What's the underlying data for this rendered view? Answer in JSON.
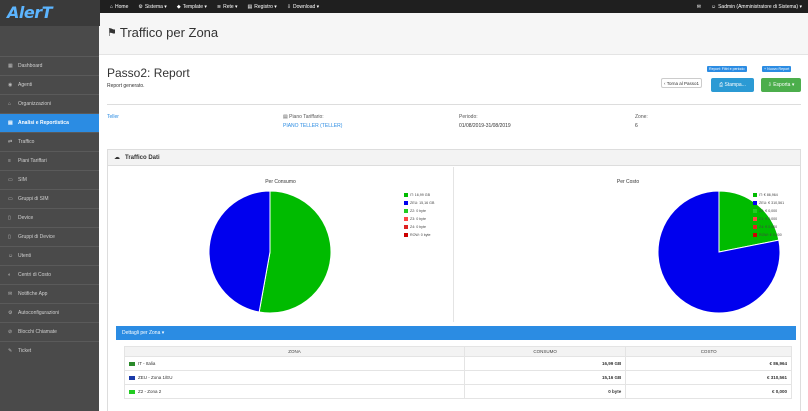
{
  "brand": {
    "logo": "AlerT",
    "accent": "#2b8ce3"
  },
  "topnav": [
    {
      "icon": "home-icon",
      "glyph": "⌂",
      "label": "Home"
    },
    {
      "icon": "gear-icon",
      "glyph": "⚙",
      "label": "Sistema ▾"
    },
    {
      "icon": "tag-icon",
      "glyph": "◆",
      "label": "Template ▾"
    },
    {
      "icon": "wifi-icon",
      "glyph": "≋",
      "label": "Rete ▾"
    },
    {
      "icon": "list-icon",
      "glyph": "▤",
      "label": "Registro ▾"
    },
    {
      "icon": "download-icon",
      "glyph": "⇩",
      "label": "Download ▾"
    }
  ],
  "topright": {
    "user": "Sadmin (Amministratore di Sistema) ▾"
  },
  "sidebar": [
    {
      "label": "Dashboard",
      "glyph": "▦",
      "icon": "dashboard-icon"
    },
    {
      "label": "Agenti",
      "glyph": "◉",
      "icon": "agent-icon"
    },
    {
      "label": "Organizzazioni",
      "glyph": "⌂",
      "icon": "building-icon"
    },
    {
      "label": "Analisi e Reportistica",
      "glyph": "▤",
      "icon": "chart-icon",
      "active": true
    },
    {
      "label": "Traffico",
      "glyph": "⇄",
      "icon": "traffic-icon"
    },
    {
      "label": "Piani Tariffari",
      "glyph": "≡",
      "icon": "plan-icon"
    },
    {
      "label": "SIM",
      "glyph": "▭",
      "icon": "sim-icon"
    },
    {
      "label": "Gruppi di SIM",
      "glyph": "▭",
      "icon": "sim-group-icon"
    },
    {
      "label": "Device",
      "glyph": "▯",
      "icon": "device-icon"
    },
    {
      "label": "Gruppi di Device",
      "glyph": "▯",
      "icon": "device-group-icon"
    },
    {
      "label": "Utenti",
      "glyph": "☺",
      "icon": "user-icon"
    },
    {
      "label": "Centri di Costo",
      "glyph": "◐",
      "icon": "cost-center-icon"
    },
    {
      "label": "Notifiche App",
      "glyph": "✉",
      "icon": "notification-icon"
    },
    {
      "label": "Autoconfigurazioni",
      "glyph": "⚙",
      "icon": "autoconfig-icon"
    },
    {
      "label": "Blocchi Chiamate",
      "glyph": "⊘",
      "icon": "block-icon"
    },
    {
      "label": "Ticket",
      "glyph": "✎",
      "icon": "ticket-icon"
    }
  ],
  "page": {
    "title": "Traffico per Zona",
    "title_icon": "⚑"
  },
  "step": {
    "title": "Passo2: Report",
    "subtitle": "Report generato."
  },
  "buttons": {
    "report_filter": "Report: Filtri e periodo",
    "new_report": "+ Nuovo Report",
    "back": "‹ Torna al Passo1",
    "print": "⎙ Stampa...",
    "export": "⇩ Esporta ▾"
  },
  "info": {
    "org": "Teller",
    "plan_label": "▤ Piano Tariffario:",
    "plan_value": "PIANO TELLER (TELLER)",
    "period_label": "Periodo:",
    "period_value": "01/08/2019-31/08/2019",
    "zones_label": "Zone:",
    "zones_value": "6"
  },
  "panel": {
    "title": "Traffico Dati",
    "icon": "☁"
  },
  "chart_data": [
    {
      "type": "pie",
      "title": "Per Consumo",
      "categories": [
        "IT",
        "ZEU",
        "Z2",
        "Z3",
        "Z4",
        "ROW"
      ],
      "legend": [
        "IT: 16,99 GB",
        "ZEU: 15,16 GB",
        "Z2: 0 byte",
        "Z3: 0 byte",
        "Z4: 0 byte",
        "ROW: 0 byte"
      ],
      "values": [
        16.99,
        15.16,
        0,
        0,
        0,
        0
      ],
      "colors": [
        "#00bb00",
        "#0000ee",
        "#22cc22",
        "#ff4444",
        "#dd2222",
        "#cc0000"
      ]
    },
    {
      "type": "pie",
      "title": "Per Costo",
      "categories": [
        "IT",
        "ZEU",
        "Z2",
        "Z3",
        "Z4",
        "ROW"
      ],
      "legend": [
        "IT: € 86,964",
        "ZEU: € 310,561",
        "Z2: € 0,000",
        "Z3: € 0,000",
        "Z4: € 0,000",
        "ROW: € 0,000"
      ],
      "values": [
        86.964,
        310.561,
        0,
        0,
        0,
        0
      ],
      "colors": [
        "#00bb00",
        "#0000ee",
        "#22cc22",
        "#ff4444",
        "#dd2222",
        "#cc0000"
      ]
    }
  ],
  "details": {
    "title": "Dettagli per Zona ▾",
    "headers": [
      "ZONA",
      "CONSUMO",
      "COSTO"
    ],
    "rows": [
      {
        "zone": "IT - Italia",
        "consumo": "16,99 GB",
        "costo": "€ 86,964",
        "flag": "#2a8a2a"
      },
      {
        "zone": "ZEU - Zona 1/EU",
        "consumo": "15,16 GB",
        "costo": "€ 310,561",
        "flag": "#1a3aa8"
      },
      {
        "zone": "Z2 - Zona 2",
        "consumo": "0 byte",
        "costo": "€ 0,000",
        "flag": "#22cc22"
      }
    ]
  }
}
